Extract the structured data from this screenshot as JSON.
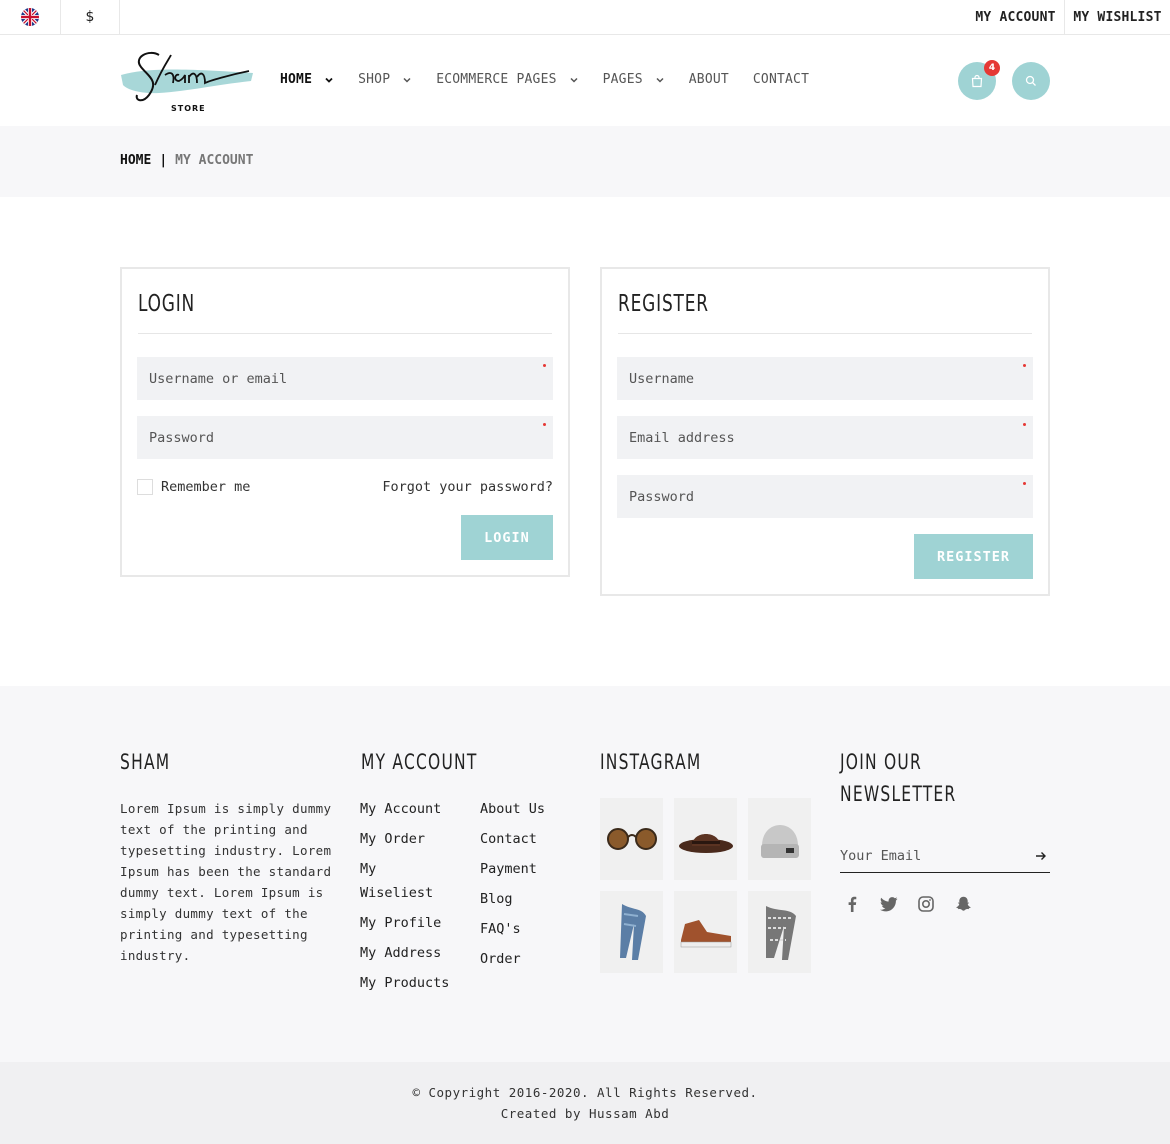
{
  "topbar": {
    "currency": "$",
    "my_account": "MY ACCOUNT",
    "my_wishlist": "MY WISHLIST"
  },
  "header": {
    "logo_script": "Sham",
    "logo_sub": "STORE",
    "nav": [
      {
        "label": "HOME",
        "dropdown": true,
        "active": true
      },
      {
        "label": "SHOP",
        "dropdown": true
      },
      {
        "label": "ECOMMERCE PAGES",
        "dropdown": true
      },
      {
        "label": "PAGES",
        "dropdown": true
      },
      {
        "label": "ABOUT",
        "dropdown": false
      },
      {
        "label": "CONTACT",
        "dropdown": false
      }
    ],
    "cart_count": "4",
    "accent": "#9fd3d4"
  },
  "breadcrumb": {
    "home": "HOME",
    "separator": "|",
    "current": "MY ACCOUNT"
  },
  "login": {
    "title": "LOGIN",
    "username_placeholder": "Username or email",
    "password_placeholder": "Password",
    "remember": "Remember me",
    "forgot": "Forgot your password?",
    "button": "LOGIN"
  },
  "register": {
    "title": "REGISTER",
    "username_placeholder": "Username",
    "email_placeholder": "Email address",
    "password_placeholder": "Password",
    "button": "REGISTER"
  },
  "footer": {
    "about_title": "SHAM",
    "about_text": "Lorem Ipsum is simply dummy text of the printing and typesetting industry. Lorem Ipsum has been the standard dummy text. Lorem Ipsum is simply dummy text of the printing and typesetting industry.",
    "account_title": "MY ACCOUNT",
    "account_links_1": [
      "My Account",
      "My Order",
      "My Wiseliest",
      "My Profile",
      "My Address",
      "My Products"
    ],
    "account_links_2": [
      "About Us",
      "Contact",
      "Payment",
      "Blog",
      "FAQ's",
      "Order"
    ],
    "instagram_title": "INSTAGRAM",
    "newsletter_title_1": "JOIN OUR",
    "newsletter_title_2": "NEWSLETTER",
    "newsletter_placeholder": "Your Email"
  },
  "copyright": {
    "line1": "© Copyright 2016-2020. All Rights Reserved.",
    "line2": "Created by Hussam Abd"
  }
}
